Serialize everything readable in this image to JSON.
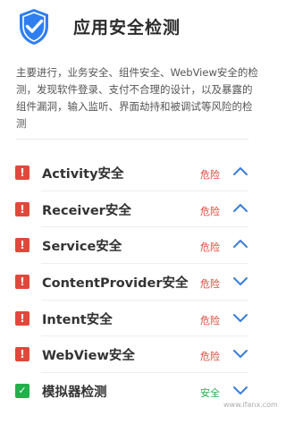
{
  "header": {
    "title": "应用安全检测",
    "icon": "shield-check-icon",
    "icon_color": "#2f7ff0"
  },
  "description": "主要进行，业务安全、组件安全、WebView安全的检测，发现软件登录、支付不合理的设计，以及暴露的组件漏洞，输入监听、界面劫持和被调试等风险的检测",
  "checks": [
    {
      "name": "Activity安全",
      "status": "危险",
      "level": "danger",
      "expanded": true
    },
    {
      "name": "Receiver安全",
      "status": "危险",
      "level": "danger",
      "expanded": true
    },
    {
      "name": "Service安全",
      "status": "危险",
      "level": "danger",
      "expanded": true
    },
    {
      "name": "ContentProvider安全",
      "status": "危险",
      "level": "danger",
      "expanded": false
    },
    {
      "name": "Intent安全",
      "status": "危险",
      "level": "danger",
      "expanded": false
    },
    {
      "name": "WebView安全",
      "status": "危险",
      "level": "danger",
      "expanded": false
    },
    {
      "name": "模拟器检测",
      "status": "安全",
      "level": "safe",
      "expanded": false
    }
  ],
  "colors": {
    "danger": "#e2473b",
    "safe": "#22b04b",
    "chevron": "#3b7dd8"
  },
  "watermark": "www.ifanx.com"
}
